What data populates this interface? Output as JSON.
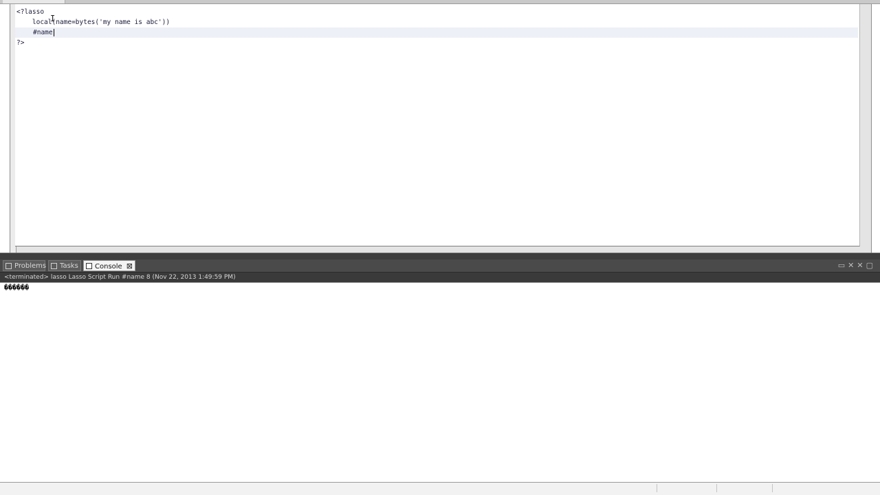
{
  "editor": {
    "lines": [
      "<?lasso",
      "    local(name=bytes('my name is abc'))",
      "    #name",
      "?>"
    ]
  },
  "console": {
    "tabs": [
      {
        "label": "Problems",
        "icon": "problems-icon"
      },
      {
        "label": "Tasks",
        "icon": "tasks-icon"
      },
      {
        "label": "Console",
        "icon": "console-icon",
        "active": true
      }
    ],
    "header": "<terminated> lasso Lasso Script Run #name 8 (Nov 22, 2013 1:49:59 PM)",
    "output": "������"
  },
  "colors": {
    "editor_background": "#ffffff",
    "current_line": "#eef0f7",
    "chrome_dark": "#4a4a4a"
  }
}
